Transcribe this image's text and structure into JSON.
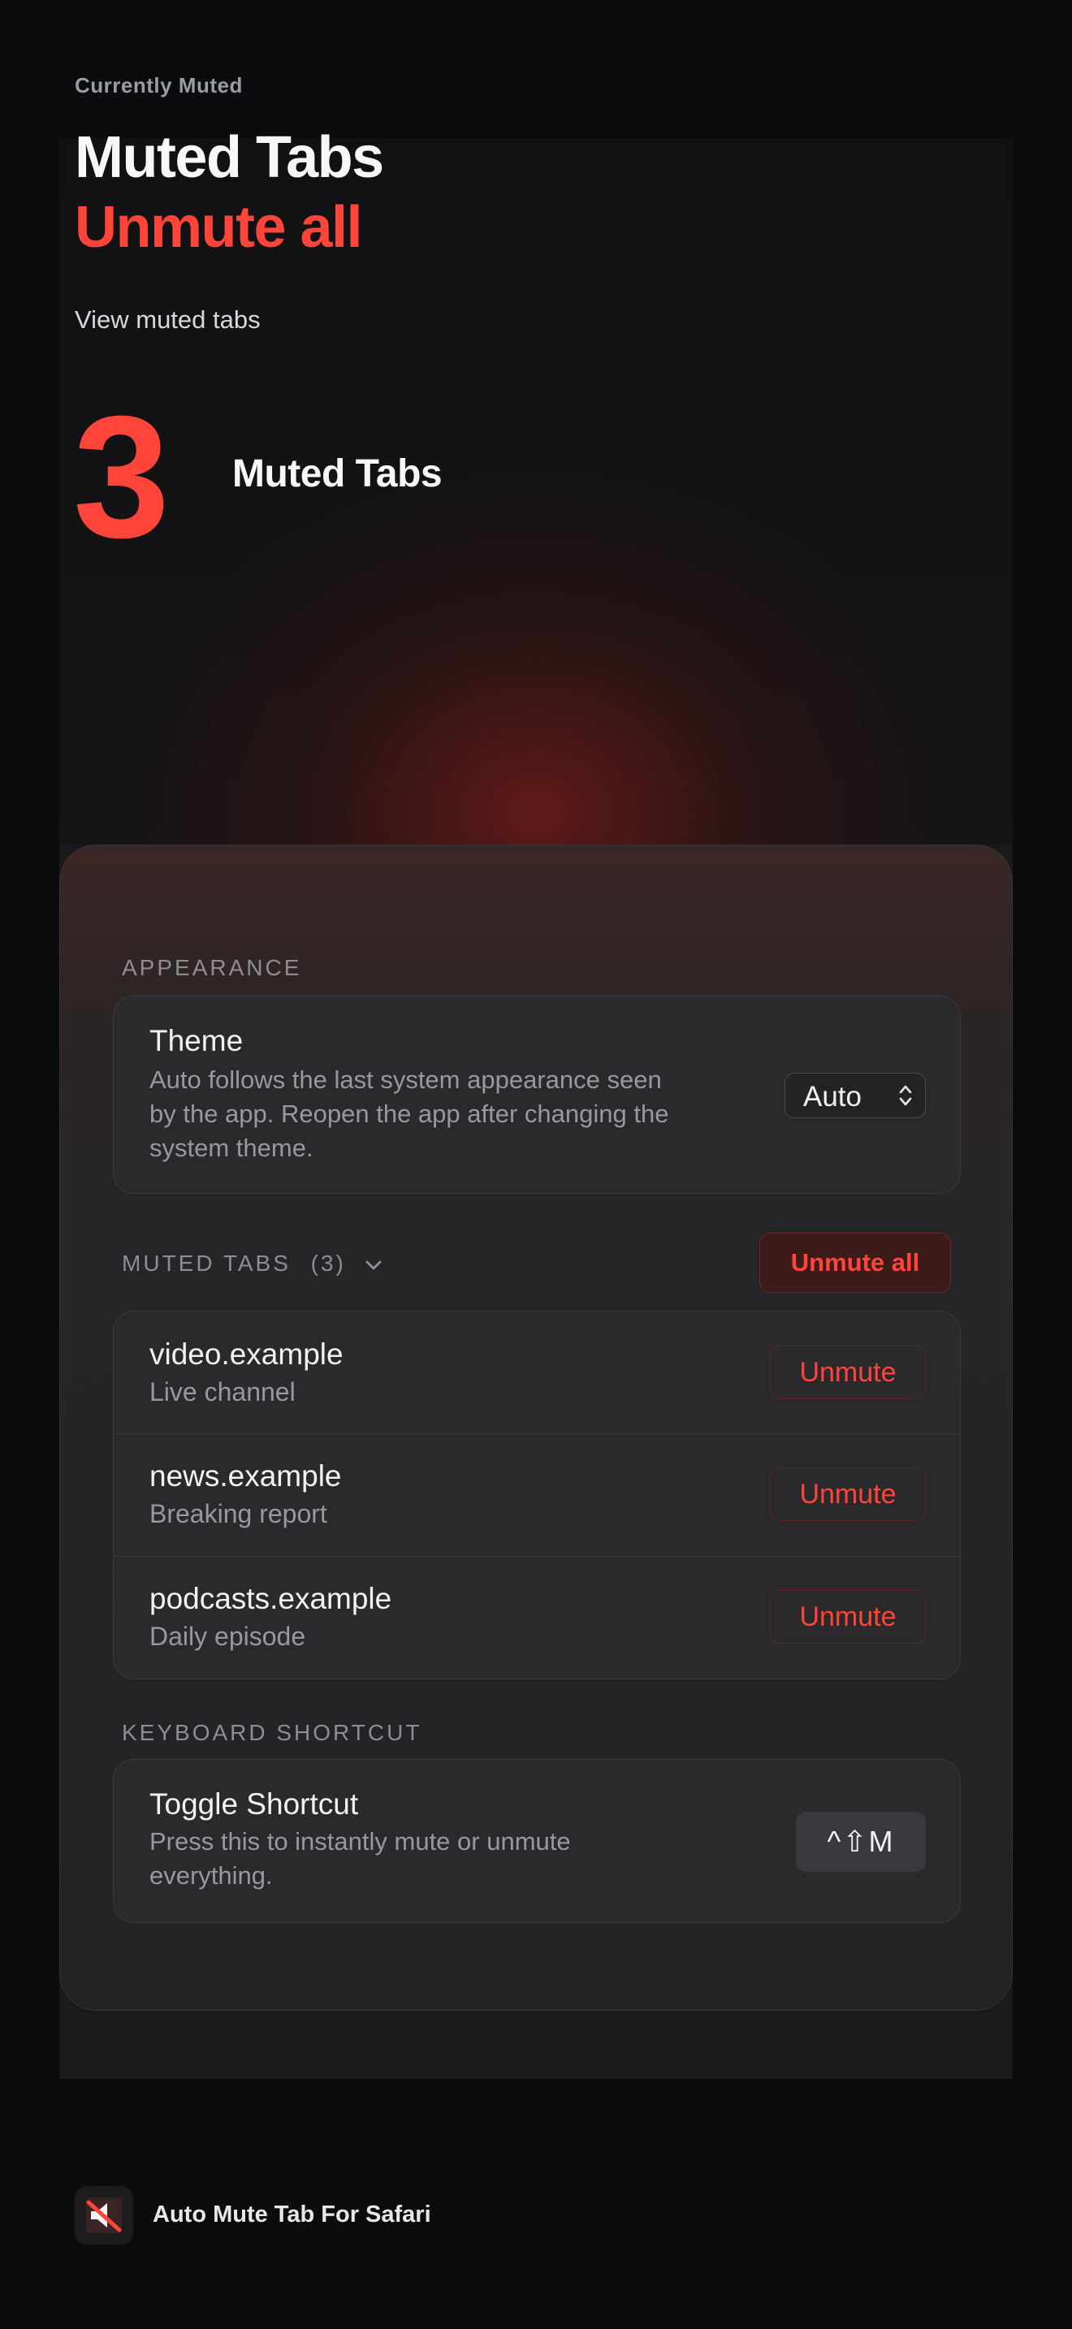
{
  "hero": {
    "eyebrow": "Currently Muted",
    "title": "Muted Tabs",
    "subtitle": "Unmute all",
    "link": "View muted tabs",
    "count": "3",
    "count_label": "Muted Tabs"
  },
  "appearance": {
    "header": "APPEARANCE",
    "theme_title": "Theme",
    "theme_desc_line1": "Auto follows the last system appearance seen",
    "theme_desc_line2": "by the app. Reopen the app after changing the",
    "theme_desc_line3": "system theme.",
    "theme_value": "Auto"
  },
  "muted_tabs": {
    "header": "MUTED TABS",
    "count": "(3)",
    "unmute_all_label": "Unmute all",
    "items": [
      {
        "domain": "video.example",
        "subtitle": "Live channel",
        "button": "Unmute"
      },
      {
        "domain": "news.example",
        "subtitle": "Breaking report",
        "button": "Unmute"
      },
      {
        "domain": "podcasts.example",
        "subtitle": "Daily episode",
        "button": "Unmute"
      }
    ]
  },
  "shortcut": {
    "header": "KEYBOARD SHORTCUT",
    "title": "Toggle Shortcut",
    "desc_line1": "Press this to instantly mute or unmute",
    "desc_line2": "everything.",
    "keys": "^⇧M"
  },
  "footer": {
    "app_name": "Auto Mute Tab For Safari",
    "icon": "muted-speaker-icon"
  },
  "colors": {
    "accent": "#ff453a",
    "background": "#0b0c0e",
    "card": "#2a2a2d"
  }
}
